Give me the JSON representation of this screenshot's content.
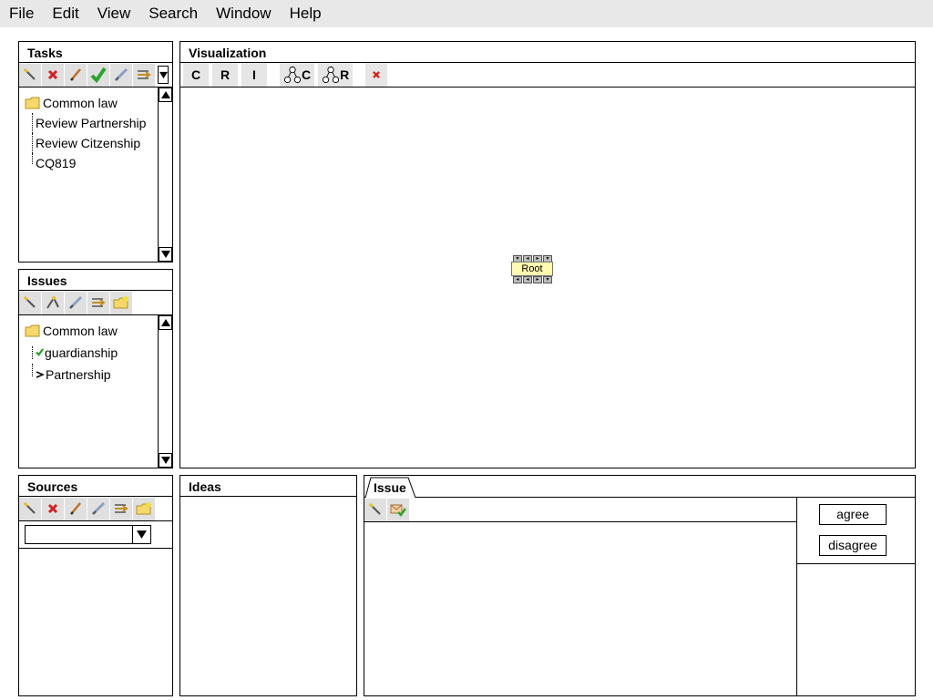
{
  "menu": [
    "File",
    "Edit",
    "View",
    "Search",
    "Window",
    "Help"
  ],
  "tasks": {
    "title": "Tasks",
    "tree": {
      "root": "Common law",
      "children": [
        "Review Partnership",
        "Review Citzenship",
        "CQ819"
      ]
    }
  },
  "issues": {
    "title": "Issues",
    "tree": {
      "root": "Common law",
      "children": [
        "guardianship",
        "Partnership"
      ]
    }
  },
  "sources": {
    "title": "Sources",
    "dropdown_value": ""
  },
  "visualization": {
    "title": "Visualization",
    "buttons": [
      "C",
      "R",
      "I",
      "C",
      "R"
    ],
    "root_label": "Root"
  },
  "ideas": {
    "title": "Ideas"
  },
  "issue_panel": {
    "tab": "Issue",
    "agree_label": "agree",
    "disagree_label": "disagree"
  },
  "colors": {
    "menubar": "#e8e8e8",
    "toolbar_button": "#e0e0e0",
    "root_node": "#fffbb0",
    "delete_red": "#d62020",
    "check_green": "#2aa52a"
  }
}
